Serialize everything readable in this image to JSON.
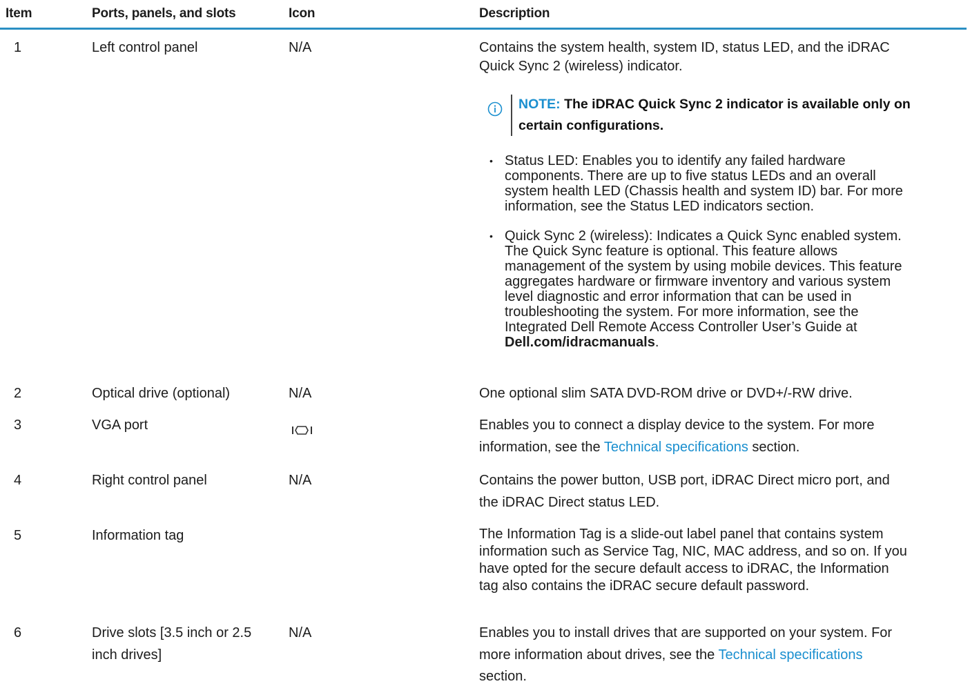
{
  "header": {
    "item": "Item",
    "ports": "Ports, panels, and slots",
    "icon": "Icon",
    "description": "Description"
  },
  "rows": [
    {
      "item": "1",
      "name": "Left control panel",
      "icon": "N/A",
      "desc_lines": [
        "Contains the system health, system ID, status LED, and the iDRAC",
        "Quick Sync 2 (wireless) indicator."
      ],
      "note": {
        "label": "NOTE:",
        "text_line1": "The iDRAC Quick Sync 2 indicator is available only on",
        "text_line2": "certain configurations."
      },
      "bullets": [
        {
          "lines": [
            "Status LED: Enables you to identify any failed hardware",
            "components. There are up to five status LEDs and an overall",
            "system health LED (Chassis health and system ID) bar. For more",
            "information, see the Status LED indicators section."
          ]
        },
        {
          "lines": [
            "Quick Sync 2 (wireless): Indicates a Quick Sync enabled system.",
            "The Quick Sync feature is optional. This feature allows",
            "management of the system by using mobile devices. This feature",
            "aggregates hardware or firmware inventory and various system",
            "level diagnostic and error information that can be used in",
            "troubleshooting the system. For more information, see the",
            "Integrated Dell Remote Access Controller User’s Guide at"
          ],
          "bold_link": "Dell.com/idracmanuals",
          "period": "."
        }
      ]
    },
    {
      "item": "2",
      "name": "Optical drive (optional)",
      "icon": "N/A",
      "desc": "One optional slim SATA DVD-ROM drive or DVD+/-RW drive."
    },
    {
      "item": "3",
      "name": "VGA port",
      "icon_name": "vga-port-icon",
      "desc_line1": "Enables you to connect a display device to the system. For more",
      "desc_line2_pre": "information, see the ",
      "desc_link": "Technical specifications",
      "desc_line2_post": " section."
    },
    {
      "item": "4",
      "name": "Right control panel",
      "icon": "N/A",
      "desc_lines": [
        "Contains the power button, USB port, iDRAC Direct micro port, and",
        "the iDRAC Direct status LED."
      ]
    },
    {
      "item": "5",
      "name": "Information tag",
      "desc_lines": [
        "The Information Tag is a slide-out label panel that contains system",
        "information such as Service Tag, NIC, MAC address, and so on. If you",
        "have opted for the secure default access to iDRAC, the Information",
        "tag also contains the iDRAC secure default password."
      ]
    },
    {
      "item": "6",
      "name_lines": [
        "Drive slots [3.5 inch or 2.5",
        "inch drives]"
      ],
      "icon": "N/A",
      "desc_line1": "Enables you to install drives that are supported on your system. For",
      "desc_line2_pre": "more information about drives, see the ",
      "desc_link": "Technical specifications",
      "desc_line3": "section."
    }
  ],
  "colors": {
    "rule": "#2a8fc3",
    "link": "#1a8fcf",
    "note_label": "#1a8fcf",
    "text": "#1c1c1c"
  },
  "icons": {
    "note": "info-circle-icon",
    "vga": "vga-port-icon"
  }
}
